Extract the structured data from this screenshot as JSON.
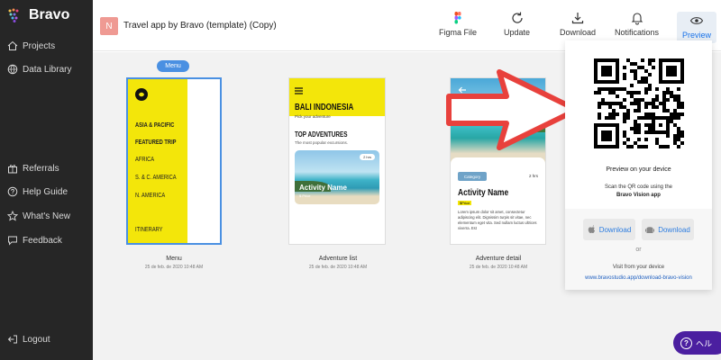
{
  "app": {
    "brand": "Bravo"
  },
  "sidebar": {
    "top_items": [
      {
        "label": "Projects",
        "icon": "home-icon"
      },
      {
        "label": "Data Library",
        "icon": "globe-icon"
      }
    ],
    "mid_items": [
      {
        "label": "Referrals",
        "icon": "gift-icon"
      },
      {
        "label": "Help Guide",
        "icon": "help-circle-icon"
      },
      {
        "label": "What's New",
        "icon": "star-icon"
      },
      {
        "label": "Feedback",
        "icon": "chat-icon"
      }
    ],
    "logout": "Logout"
  },
  "header": {
    "avatar_letter": "N",
    "project_title": "Travel app by Bravo (template) (Copy)",
    "tools": [
      {
        "label": "Figma File",
        "icon": "figma-icon"
      },
      {
        "label": "Update",
        "icon": "refresh-icon"
      },
      {
        "label": "Download",
        "icon": "download-icon"
      },
      {
        "label": "Notifications",
        "icon": "bell-icon"
      },
      {
        "label": "Preview",
        "icon": "eye-icon"
      }
    ]
  },
  "screens": [
    {
      "name": "Menu",
      "date": "25 de feb. de 2020 10:48 AM",
      "badge": "Menu",
      "items": [
        "ASIA & PACIFIC",
        "FEATURED TRIP",
        "AFRICA",
        "S. & C. AMERICA",
        "N. AMERICA",
        "ITINERARY"
      ]
    },
    {
      "name": "Adventure list",
      "date": "25 de feb. de 2020 10:48 AM",
      "heading": "BALI INDONESIA",
      "subheading": "Pick your adventure",
      "section": "TOP ADVENTURES",
      "section_sub": "The most popular excursions.",
      "card_title": "Activity Name",
      "card_price": "$ Price",
      "card_duration": "2 hrs"
    },
    {
      "name": "Adventure detail",
      "date": "25 de feb. de 2020 10:48 AM",
      "category": "Category",
      "duration": "2 hrs",
      "title": "Activity Name",
      "price": "$Price",
      "body": "Lorem ipsum dolor sit amet, consectetur adipiscing elit. Dignissim turpis sit vitae, nec elementum eget vita. Sed nullam luctus ultrices viverra. Est"
    }
  ],
  "preview_panel": {
    "title": "Preview on your device",
    "instruction": "Scan the QR code using the",
    "app_name": "Bravo Vision app",
    "download_ios": "Download",
    "download_android": "Download",
    "or": "or",
    "visit": "Visit from your device",
    "link": "www.bravostudio.app/download-bravo-vision"
  },
  "help_badge": "ヘル"
}
